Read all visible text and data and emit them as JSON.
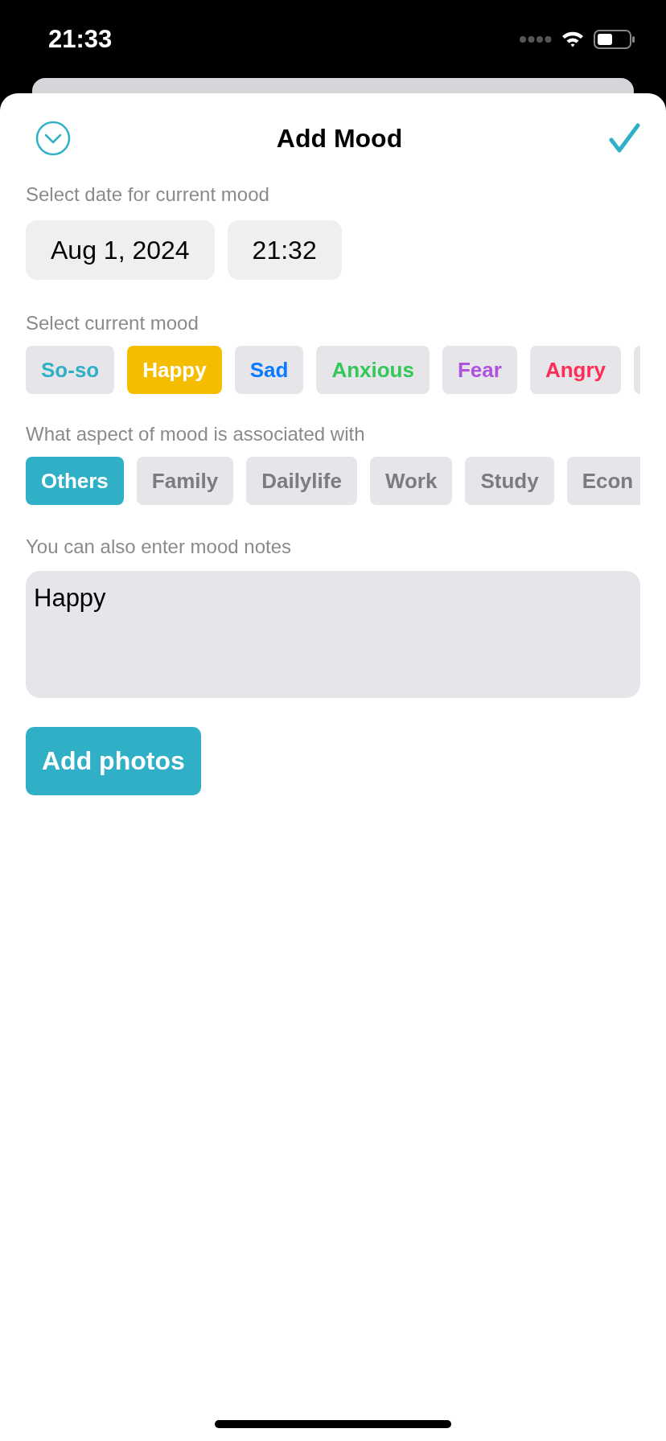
{
  "status_bar": {
    "time": "21:33"
  },
  "header": {
    "title": "Add Mood"
  },
  "date_section": {
    "label": "Select date for current mood",
    "date": "Aug 1, 2024",
    "time": "21:32"
  },
  "mood_section": {
    "label": "Select current mood",
    "moods": [
      {
        "label": "So-so",
        "color": "#30b0c7",
        "selected": false
      },
      {
        "label": "Happy",
        "color": "#f5bd00",
        "selected": true
      },
      {
        "label": "Sad",
        "color": "#0a7aff",
        "selected": false
      },
      {
        "label": "Anxious",
        "color": "#34c759",
        "selected": false
      },
      {
        "label": "Fear",
        "color": "#af52de",
        "selected": false
      },
      {
        "label": "Angry",
        "color": "#ff2d55",
        "selected": false
      }
    ]
  },
  "aspect_section": {
    "label": "What aspect of mood is associated with",
    "aspects": [
      {
        "label": "Others",
        "selected": true
      },
      {
        "label": "Family",
        "selected": false
      },
      {
        "label": "Dailylife",
        "selected": false
      },
      {
        "label": "Work",
        "selected": false
      },
      {
        "label": "Study",
        "selected": false
      },
      {
        "label": "Econ",
        "selected": false
      }
    ]
  },
  "notes_section": {
    "label": "You can also enter mood notes",
    "value": "Happy"
  },
  "add_photos_button": "Add photos"
}
